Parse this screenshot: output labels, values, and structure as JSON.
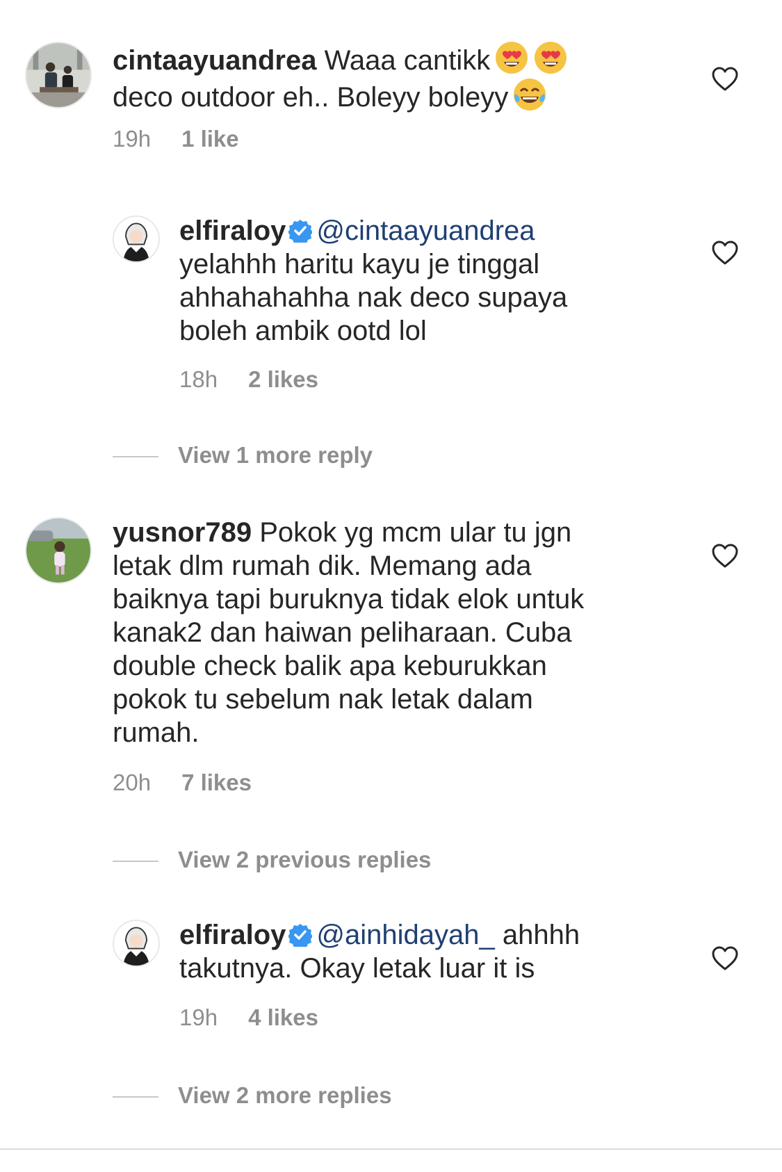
{
  "comments": [
    {
      "username": "cintaayuandrea",
      "line1": "Waaa cantikk",
      "line2": "deco outdoor eh.. Boleyy boleyy",
      "time": "19h",
      "likes": "1 like"
    },
    {
      "username": "elfiraloy",
      "mention": "@cintaayuandrea",
      "line1": "yelahhh haritu kayu je tinggal",
      "line2": "ahhahahahha nak deco supaya",
      "line3": "boleh ambik ootd lol",
      "time": "18h",
      "likes": "2 likes",
      "view_replies": "View 1 more reply"
    },
    {
      "username": "yusnor789",
      "line1": "Pokok yg mcm ular tu jgn",
      "line2": "letak dlm rumah dik. Memang ada",
      "line3": "baiknya tapi buruknya tidak elok untuk",
      "line4": "kanak2 dan haiwan peliharaan. Cuba",
      "line5": "double check balik apa keburukkan",
      "line6": "pokok tu sebelum nak letak dalam",
      "line7": "rumah.",
      "time": "20h",
      "likes": "7 likes",
      "view_replies": "View 2 previous replies"
    },
    {
      "username": "elfiraloy",
      "mention": "@ainhidayah_",
      "line1": "ahhhh",
      "line2": "takutnya. Okay letak luar it is",
      "time": "19h",
      "likes": "4 likes",
      "view_replies": "View 2 more replies"
    }
  ],
  "icons": {
    "heart": "heart-icon",
    "verified": "verified-badge-icon",
    "emoji_heart_eyes": "heart-eyes-emoji",
    "emoji_laugh": "tears-of-joy-emoji"
  },
  "colors": {
    "text": "#262626",
    "secondary": "#8e8e8e",
    "mention": "#1f3f74",
    "verified": "#3897f0"
  }
}
